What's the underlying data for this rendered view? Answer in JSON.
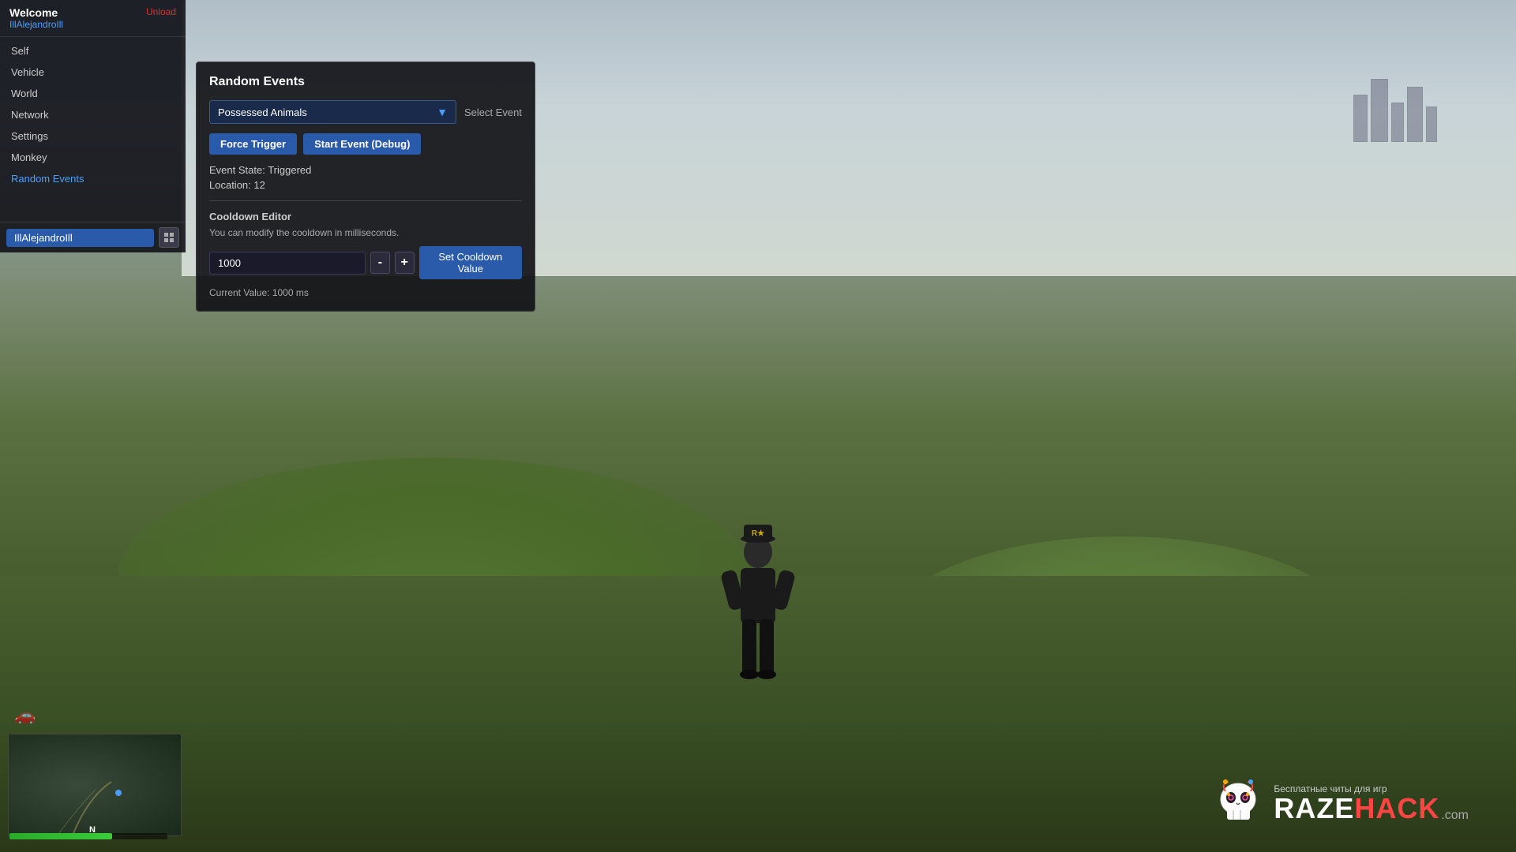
{
  "sidebar": {
    "header": {
      "welcome": "Welcome",
      "username": "IllAlejandroIll",
      "unload_label": "Unload"
    },
    "nav_items": [
      {
        "label": "Self",
        "active": false,
        "id": "self"
      },
      {
        "label": "Vehicle",
        "active": false,
        "id": "vehicle"
      },
      {
        "label": "World",
        "active": false,
        "id": "world"
      },
      {
        "label": "Network",
        "active": false,
        "id": "network"
      },
      {
        "label": "Settings",
        "active": false,
        "id": "settings"
      },
      {
        "label": "Monkey",
        "active": false,
        "id": "monkey"
      },
      {
        "label": "Random Events",
        "active": true,
        "id": "random-events"
      }
    ],
    "footer_username": "IllAlejandroIll"
  },
  "random_events_panel": {
    "title": "Random Events",
    "selected_event": "Possessed Animals",
    "select_event_label": "Select Event",
    "btn_force_trigger": "Force Trigger",
    "btn_start_event_debug": "Start Event (Debug)",
    "event_state_label": "Event State: Triggered",
    "location_label": "Location: 12",
    "cooldown_editor_title": "Cooldown Editor",
    "cooldown_desc": "You can modify the cooldown in milliseconds.",
    "cooldown_value": "1000",
    "btn_decrement": "-",
    "btn_increment": "+",
    "btn_set_cooldown": "Set Cooldown Value",
    "current_value_label": "Current Value: 1000 ms"
  },
  "hud": {
    "compass": "N",
    "car_symbol": "🚗"
  },
  "watermark": {
    "sub_text": "Бесплатные читы для игр",
    "brand_raze": "RAZE",
    "brand_hack": "HACK",
    "domain": ".com"
  }
}
